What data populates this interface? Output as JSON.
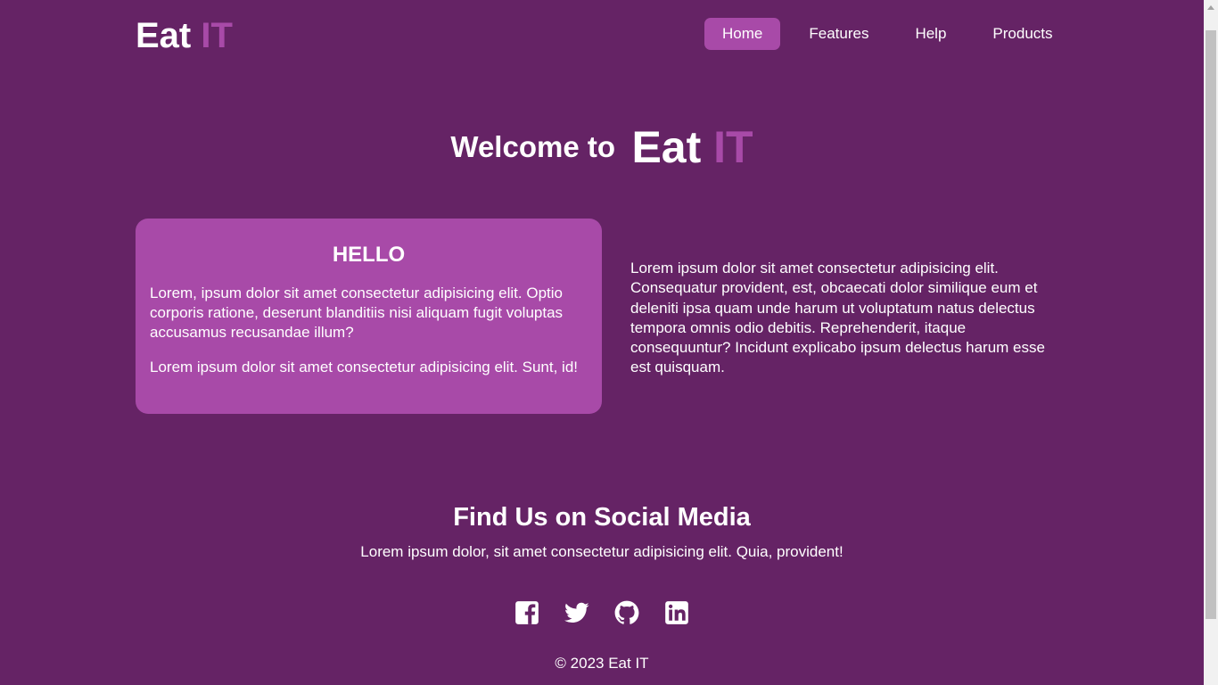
{
  "header": {
    "logo_main": "Eat",
    "logo_accent": "IT",
    "nav": [
      {
        "label": "Home",
        "active": true
      },
      {
        "label": "Features",
        "active": false
      },
      {
        "label": "Help",
        "active": false
      },
      {
        "label": "Products",
        "active": false
      }
    ]
  },
  "hero": {
    "welcome": "Welcome to",
    "brand_main": "Eat",
    "brand_accent": "IT"
  },
  "card": {
    "title": "HELLO",
    "paragraph1": "Lorem, ipsum dolor sit amet consectetur adipisicing elit. Optio corporis ratione, deserunt blanditiis nisi aliquam fugit voluptas accusamus recusandae illum?",
    "paragraph2": "Lorem ipsum dolor sit amet consectetur adipisicing elit. Sunt, id!"
  },
  "side_text": "Lorem ipsum dolor sit amet consectetur adipisicing elit. Consequatur provident, est, obcaecati dolor similique eum et deleniti ipsa quam unde harum ut voluptatum natus delectus tempora omnis odio debitis. Reprehenderit, itaque consequuntur? Incidunt explicabo ipsum delectus harum esse est quisquam.",
  "social": {
    "title": "Find Us on Social Media",
    "subtitle": "Lorem ipsum dolor, sit amet consectetur adipisicing elit. Quia, provident!",
    "icons": [
      "facebook-icon",
      "twitter-icon",
      "github-icon",
      "linkedin-icon"
    ]
  },
  "footer": {
    "copyright": "© 2023 Eat IT"
  },
  "colors": {
    "background": "#652365",
    "accent": "#a84aa8",
    "text": "#ffffff"
  }
}
